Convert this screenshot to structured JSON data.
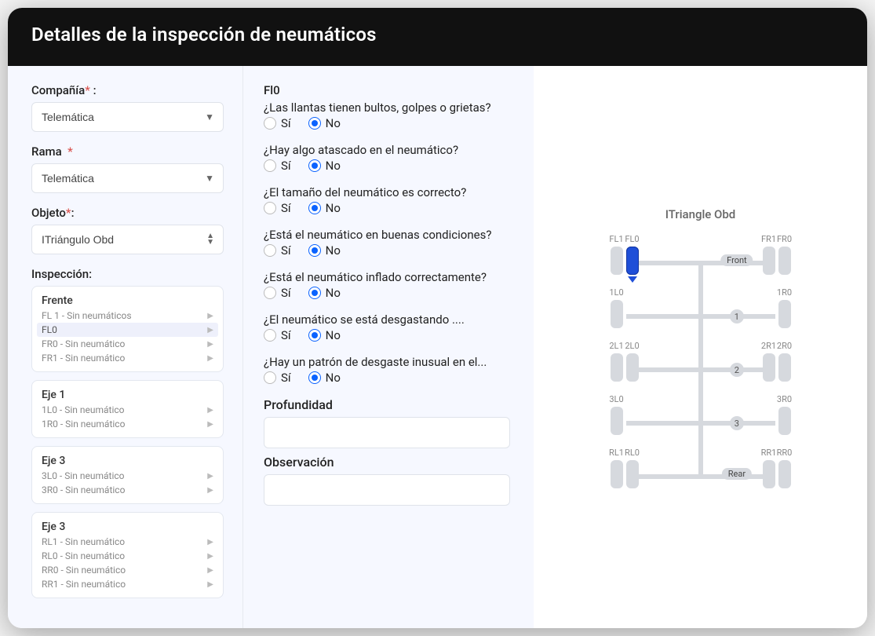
{
  "header": {
    "title": "Detalles de la inspección de neumáticos"
  },
  "form": {
    "company_label": "Compañía",
    "branch_label": "Rama",
    "object_label": "Objeto",
    "inspection_label": "Inspección:",
    "company_value": "Telemática",
    "branch_value": "Telemática",
    "object_value": "ITriángulo Obd"
  },
  "colon": ":",
  "asterisk": "*",
  "inspection_groups": [
    {
      "name": "Frente",
      "rows": [
        {
          "label": "FL 1 - Sin neumáticos",
          "active": false
        },
        {
          "label": "FL0",
          "active": true
        },
        {
          "label": "FR0 - Sin neumático",
          "active": false
        },
        {
          "label": "FR1 - Sin neumático",
          "active": false
        }
      ]
    },
    {
      "name": "Eje 1",
      "rows": [
        {
          "label": "1L0 - Sin neumático",
          "active": false
        },
        {
          "label": "1R0 - Sin neumático",
          "active": false
        }
      ]
    },
    {
      "name": "Eje 3",
      "rows": [
        {
          "label": "3L0 - Sin neumático",
          "active": false
        },
        {
          "label": "3R0 - Sin neumático",
          "active": false
        }
      ]
    },
    {
      "name": "Eje 3",
      "rows": [
        {
          "label": "RL1 - Sin neumático",
          "active": false
        },
        {
          "label": "RL0 - Sin neumático",
          "active": false
        },
        {
          "label": "RR0 - Sin neumático",
          "active": false
        },
        {
          "label": "RR1 - Sin neumático",
          "active": false
        }
      ]
    }
  ],
  "tire_section": {
    "current_tire": "Fl0",
    "options": {
      "yes": "Sí",
      "no": "No"
    },
    "questions": [
      "¿Las llantas tienen bultos, golpes o grietas?",
      "¿Hay algo atascado en el neumático?",
      "¿El tamaño del neumático es correcto?",
      "¿Está el neumático en buenas condiciones?",
      "¿Está el neumático inflado correctamente?",
      "¿El neumático se está desgastando ....",
      "¿Hay un patrón de desgaste inusual en el..."
    ],
    "depth_label": "Profundidad",
    "observation_label": "Observación"
  },
  "diagram": {
    "title": "ITriangle Obd",
    "selected": "FL0",
    "axles": [
      {
        "tag": "Front",
        "left": [
          "FL1",
          "FL0"
        ],
        "right": [
          "FR0",
          "FR1"
        ]
      },
      {
        "tag": "1",
        "left": [
          "1L0"
        ],
        "right": [
          "1R0"
        ]
      },
      {
        "tag": "2",
        "left": [
          "2L1",
          "2L0"
        ],
        "right": [
          "2R0",
          "2R1"
        ]
      },
      {
        "tag": "3",
        "left": [
          "3L0"
        ],
        "right": [
          "3R0"
        ]
      },
      {
        "tag": "Rear",
        "left": [
          "RL1",
          "RL0"
        ],
        "right": [
          "RR0",
          "RR1"
        ]
      }
    ]
  }
}
